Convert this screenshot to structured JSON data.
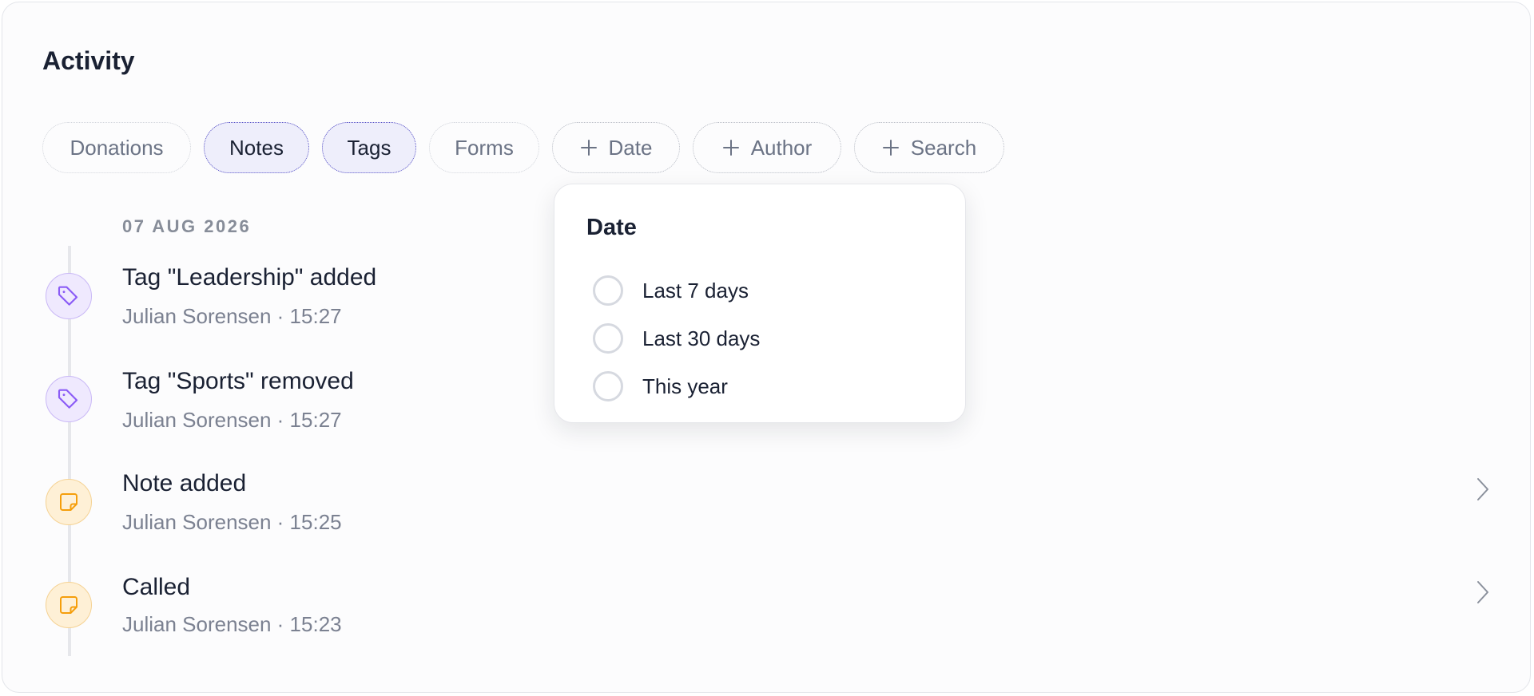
{
  "header": {
    "title": "Activity"
  },
  "filters": [
    {
      "label": "Donations",
      "state": "inactive"
    },
    {
      "label": "Notes",
      "state": "active"
    },
    {
      "label": "Tags",
      "state": "active"
    },
    {
      "label": "Forms",
      "state": "inactive"
    },
    {
      "label": "Date",
      "state": "add"
    },
    {
      "label": "Author",
      "state": "add"
    },
    {
      "label": "Search",
      "state": "add"
    }
  ],
  "timeline": {
    "date": "07 AUG 2026",
    "items": [
      {
        "icon": "tag-icon",
        "title": "Tag \"Leadership\" added",
        "meta": "Julian Sorensen · 15:27",
        "has_chevron": false
      },
      {
        "icon": "tag-icon",
        "title": "Tag \"Sports\" removed",
        "meta": "Julian Sorensen · 15:27",
        "has_chevron": false
      },
      {
        "icon": "note-icon",
        "title": "Note added",
        "meta": "Julian Sorensen · 15:25",
        "has_chevron": true
      },
      {
        "icon": "note-icon",
        "title": "Called",
        "meta": "Julian Sorensen · 15:23",
        "has_chevron": true
      }
    ]
  },
  "date_popover": {
    "title": "Date",
    "options": [
      "Last 7 days",
      "Last 30 days",
      "This year"
    ]
  },
  "colors": {
    "accent": "#5650c6",
    "active_chip_bg": "#eeeefb",
    "tag_icon": "#8b5cf6",
    "note_icon": "#f59e0b"
  }
}
